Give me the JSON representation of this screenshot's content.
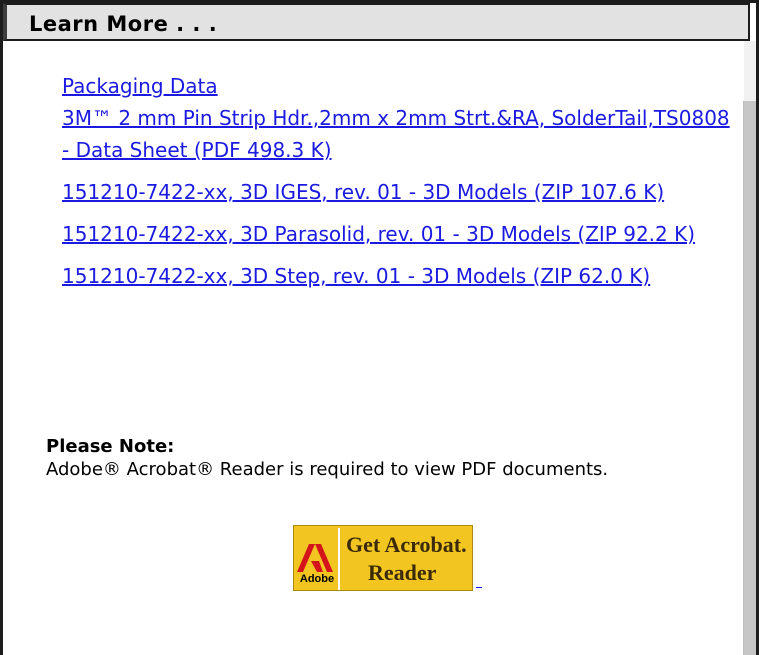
{
  "header": {
    "title": "Learn More . . ."
  },
  "links": [
    {
      "label": "Packaging Data"
    },
    {
      "label": "3M™ 2 mm Pin Strip Hdr.,2mm x 2mm Strt.&RA, SolderTail,TS0808 - Data Sheet (PDF 498.3 K)"
    },
    {
      "label": "151210-7422-xx, 3D IGES, rev. 01 - 3D Models (ZIP 107.6 K)"
    },
    {
      "label": "151210-7422-xx, 3D Parasolid, rev. 01 - 3D Models (ZIP 92.2 K)"
    },
    {
      "label": "151210-7422-xx, 3D Step, rev. 01 - 3D Models (ZIP 62.0 K)"
    }
  ],
  "note": {
    "title": "Please Note:",
    "text": "Adobe® Acrobat® Reader is required to view PDF documents."
  },
  "badge": {
    "brand": "Adobe",
    "line1": "Get Acrobat.",
    "line2": "Reader",
    "icon": "adobe-logo-icon"
  },
  "colors": {
    "link": "#1a1ae0",
    "header_bg": "#e2e2e2",
    "badge_bg": "#f2c521",
    "adobe_red": "#d4161c"
  }
}
